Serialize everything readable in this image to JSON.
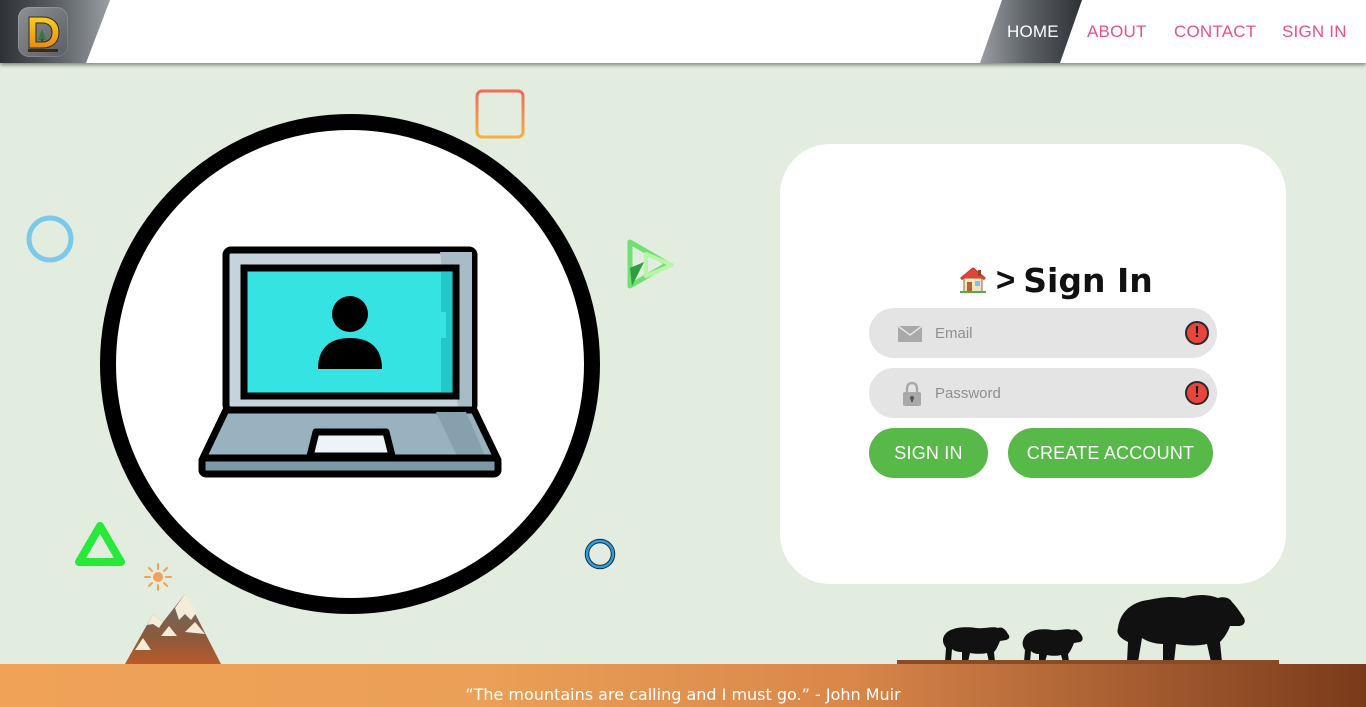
{
  "navbar": {
    "logo_letter": "D",
    "links": [
      {
        "label": "HOME",
        "active": true
      },
      {
        "label": "ABOUT",
        "active": false
      },
      {
        "label": "CONTACT",
        "active": false
      },
      {
        "label": "SIGN IN",
        "active": false
      }
    ],
    "link_color": "#e8508f"
  },
  "signin": {
    "title_separator": ">",
    "title": "Sign In",
    "email_placeholder": "Email",
    "password_placeholder": "Password",
    "warning_glyph": "!",
    "sign_in_button": "SIGN IN",
    "create_account_button": "CREATE ACCOUNT",
    "button_color": "#57b947"
  },
  "footer": {
    "quote": "“The mountains are calling and I must go.” - John Muir"
  },
  "icons": [
    "logo-icon",
    "laptop-user-icon",
    "house-icon",
    "email-icon",
    "lock-icon",
    "warning-icon",
    "bear-icon",
    "mountain-icon"
  ],
  "colors": {
    "background": "#e2eddf",
    "card": "#ffffff",
    "field": "#e4e4e4",
    "warning": "#e8453c"
  }
}
